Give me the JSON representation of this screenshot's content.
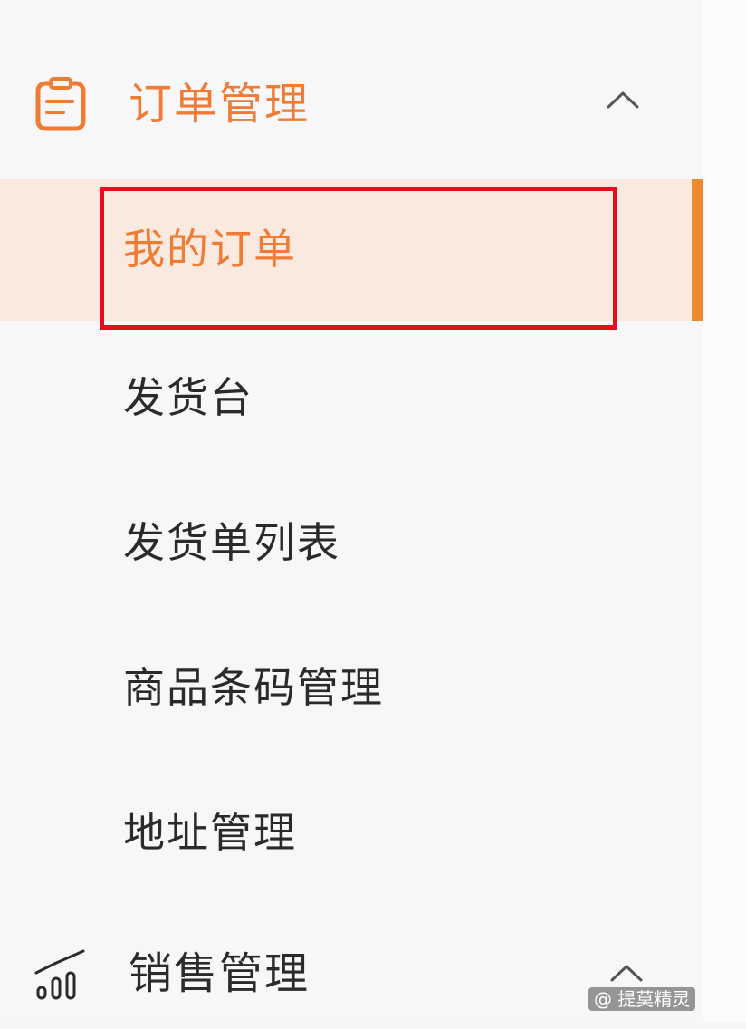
{
  "colors": {
    "accent": "#ef7b34",
    "active_bg": "#f9e9de",
    "active_bar": "#ee8a2e",
    "highlight_border": "#e3101c",
    "text": "#2a2a2a"
  },
  "sidebar": {
    "groups": [
      {
        "title": "订单管理",
        "icon": "clipboard-icon",
        "expanded": true,
        "items": [
          {
            "label": "我的订单",
            "active": true
          },
          {
            "label": "发货台",
            "active": false
          },
          {
            "label": "发货单列表",
            "active": false
          },
          {
            "label": "商品条码管理",
            "active": false
          },
          {
            "label": "地址管理",
            "active": false
          }
        ]
      },
      {
        "title": "销售管理",
        "icon": "bar-chart-icon",
        "expanded": true,
        "items": []
      }
    ]
  },
  "watermark": "@ 提莫精灵"
}
